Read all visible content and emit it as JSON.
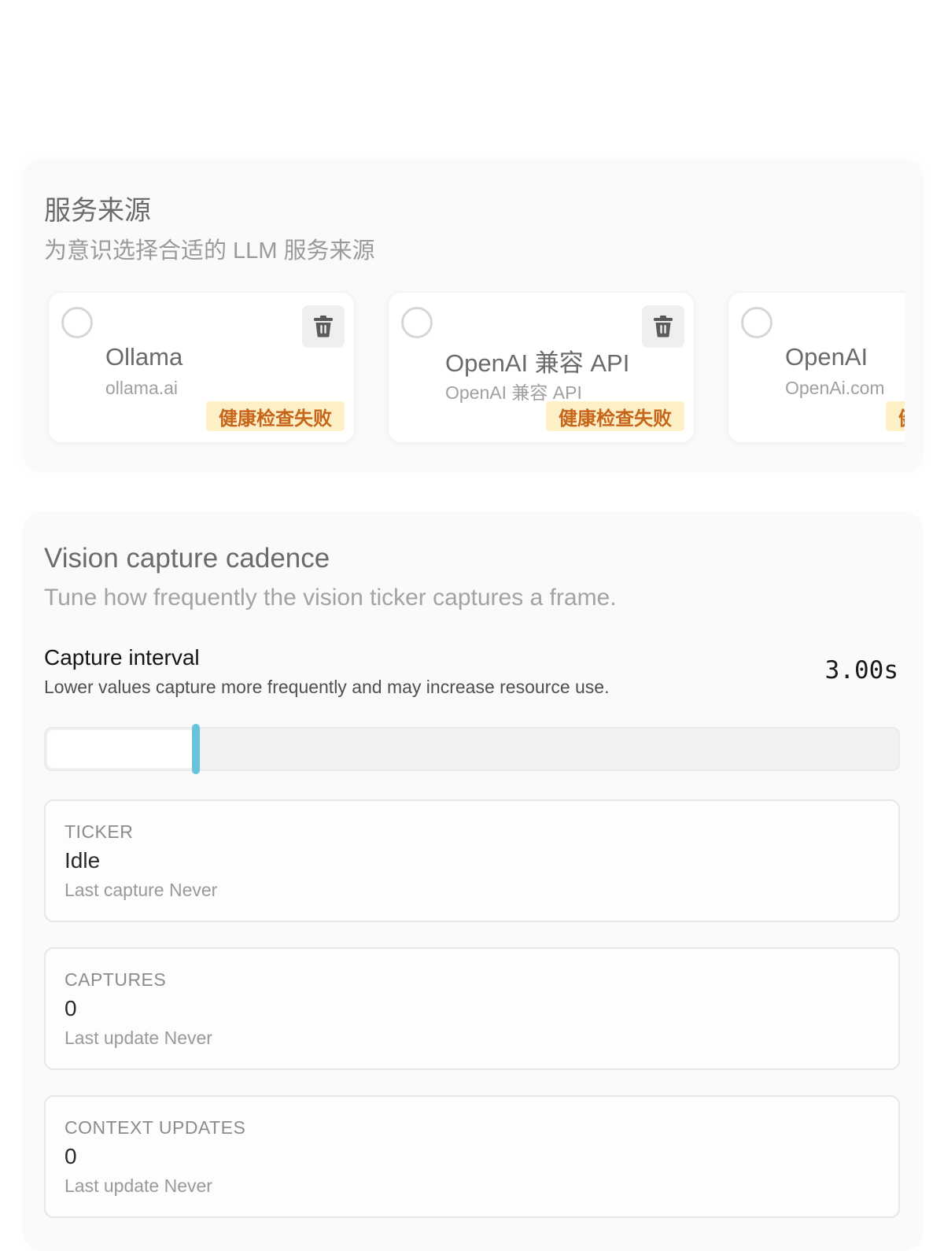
{
  "provider_section": {
    "title": "服务来源",
    "subtitle": "为意识选择合适的 LLM 服务来源",
    "cards": [
      {
        "name": "Ollama",
        "url": "ollama.ai",
        "badge": "健康检查失败",
        "selected": false,
        "delete_icon": "trash-icon"
      },
      {
        "name": "OpenAI 兼容 API",
        "url": "OpenAI 兼容 API",
        "badge": "健康检查失败",
        "selected": false,
        "delete_icon": "trash-icon"
      },
      {
        "name": "OpenAI",
        "url": "OpenAi.com",
        "badge": "健康检查失败",
        "selected": false,
        "delete_icon": "trash-icon"
      }
    ]
  },
  "vision_section": {
    "title": "Vision capture cadence",
    "subtitle": "Tune how frequently the vision ticker captures a frame.",
    "capture_interval": {
      "label": "Capture interval",
      "description": "Lower values capture more frequently and may increase resource use.",
      "value_text": "3.00s",
      "slider_fraction": 0.175
    },
    "stats": [
      {
        "label": "TICKER",
        "value": "Idle",
        "meta": "Last capture Never"
      },
      {
        "label": "CAPTURES",
        "value": "0",
        "meta": "Last update Never"
      },
      {
        "label": "CONTEXT UPDATES",
        "value": "0",
        "meta": "Last update Never"
      }
    ]
  },
  "colors": {
    "badge_bg": "#fdf0c6",
    "badge_text": "#c7651a",
    "slider_thumb": "#69c3dd",
    "section_bg": "#faf9fb"
  }
}
